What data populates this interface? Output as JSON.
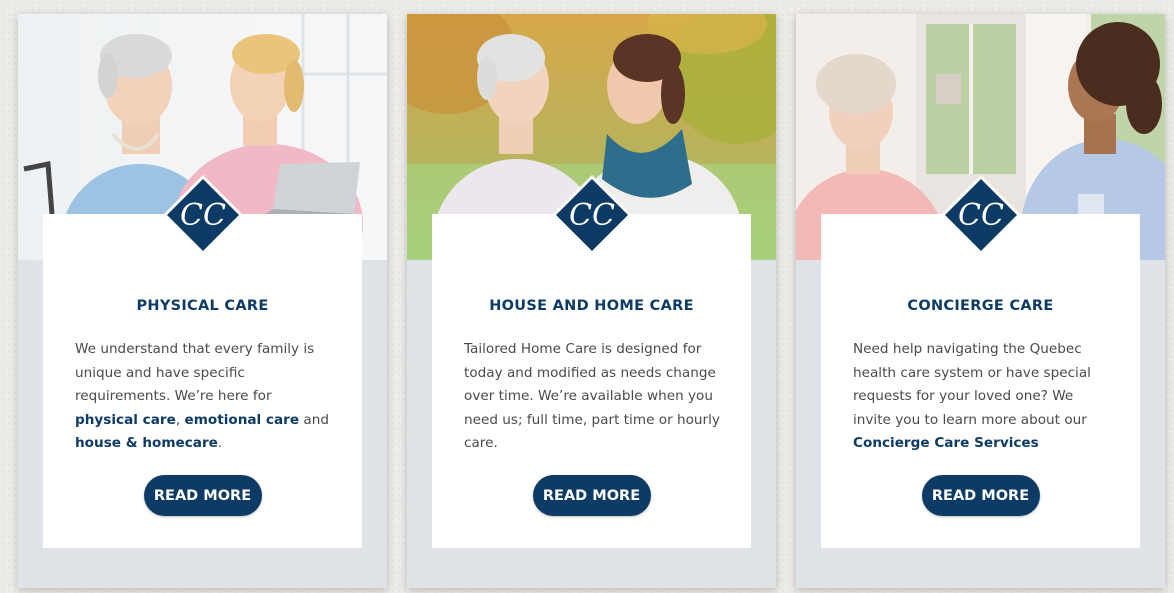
{
  "cards": [
    {
      "title": "PHYSICAL CARE",
      "text_parts": [
        {
          "text": "We understand that every family is unique and have specific requirements. We’re here for ",
          "link": false
        },
        {
          "text": "physical care",
          "link": true
        },
        {
          "text": ", ",
          "link": false
        },
        {
          "text": "emotional care",
          "link": true
        },
        {
          "text": " and ",
          "link": false
        },
        {
          "text": "house & homecare",
          "link": true
        },
        {
          "text": ".",
          "link": false
        }
      ],
      "button": "READ MORE",
      "logo_monogram": "CC"
    },
    {
      "title": "HOUSE AND HOME CARE",
      "text_parts": [
        {
          "text": "Tailored Home Care is designed for today and modified as needs change over time. We’re available when you need us; full time, part time or hourly care.",
          "link": false
        }
      ],
      "button": "READ MORE",
      "logo_monogram": "CC"
    },
    {
      "title": "CONCIERGE CARE",
      "text_parts": [
        {
          "text": "Need help navigating the Quebec health care system or have special requests for your loved one? We invite you to learn more about our ",
          "link": false
        },
        {
          "text": "Concierge Care Services",
          "link": true
        }
      ],
      "button": "READ MORE",
      "logo_monogram": "CC"
    }
  ],
  "colors": {
    "brand_navy": "#0d3b66",
    "card_bg": "#dfe2e7",
    "body_text": "#4a4a4a"
  }
}
